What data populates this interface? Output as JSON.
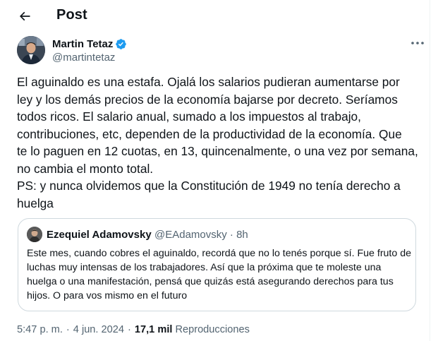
{
  "header": {
    "title": "Post"
  },
  "tweet": {
    "author_name": "Martin Tetaz",
    "author_handle": "@martintetaz",
    "text": "El aguinaldo es una estafa. Ojalá los salarios pudieran aumentarse por\nley y los demás precios de la economía bajarse por decreto. Seríamos\ntodos ricos. El salario anual, sumado a los impuestos al trabajo,\ncontribuciones, etc, dependen de la productividad de la economía. Que\nte lo paguen en 12 cuotas, en 13, quincenalmente, o una vez por semana,\nno cambia el monto total.\nPS: y nunca olvidemos que la Constitución de 1949 no tenía derecho a\nhuelga",
    "time": "5:47 p. m.",
    "separator": "·",
    "date": "4 jun. 2024",
    "views_count": "17,1 mil",
    "views_label": "Reproducciones"
  },
  "quote": {
    "author_name": "Ezequiel Adamovsky",
    "author_handle": "@EAdamovsky · 8h",
    "text": "Este mes, cuando cobres el aguinaldo, recordá que no lo tenés porque sí. Fue fruto de luchas muy intensas de los trabajadores. Así que la próxima que te moleste una huelga o una manifestación, pensá que quizás está asegurando derechos para tus hijos. O para vos mismo en el futuro"
  },
  "colors": {
    "text": "#0f1419",
    "secondary": "#536471",
    "verified": "#1d9bf0",
    "border": "#cfd9de"
  },
  "icons": {
    "back": "arrow-left-icon",
    "verified": "verified-badge-icon",
    "more": "more-horizontal-icon"
  }
}
